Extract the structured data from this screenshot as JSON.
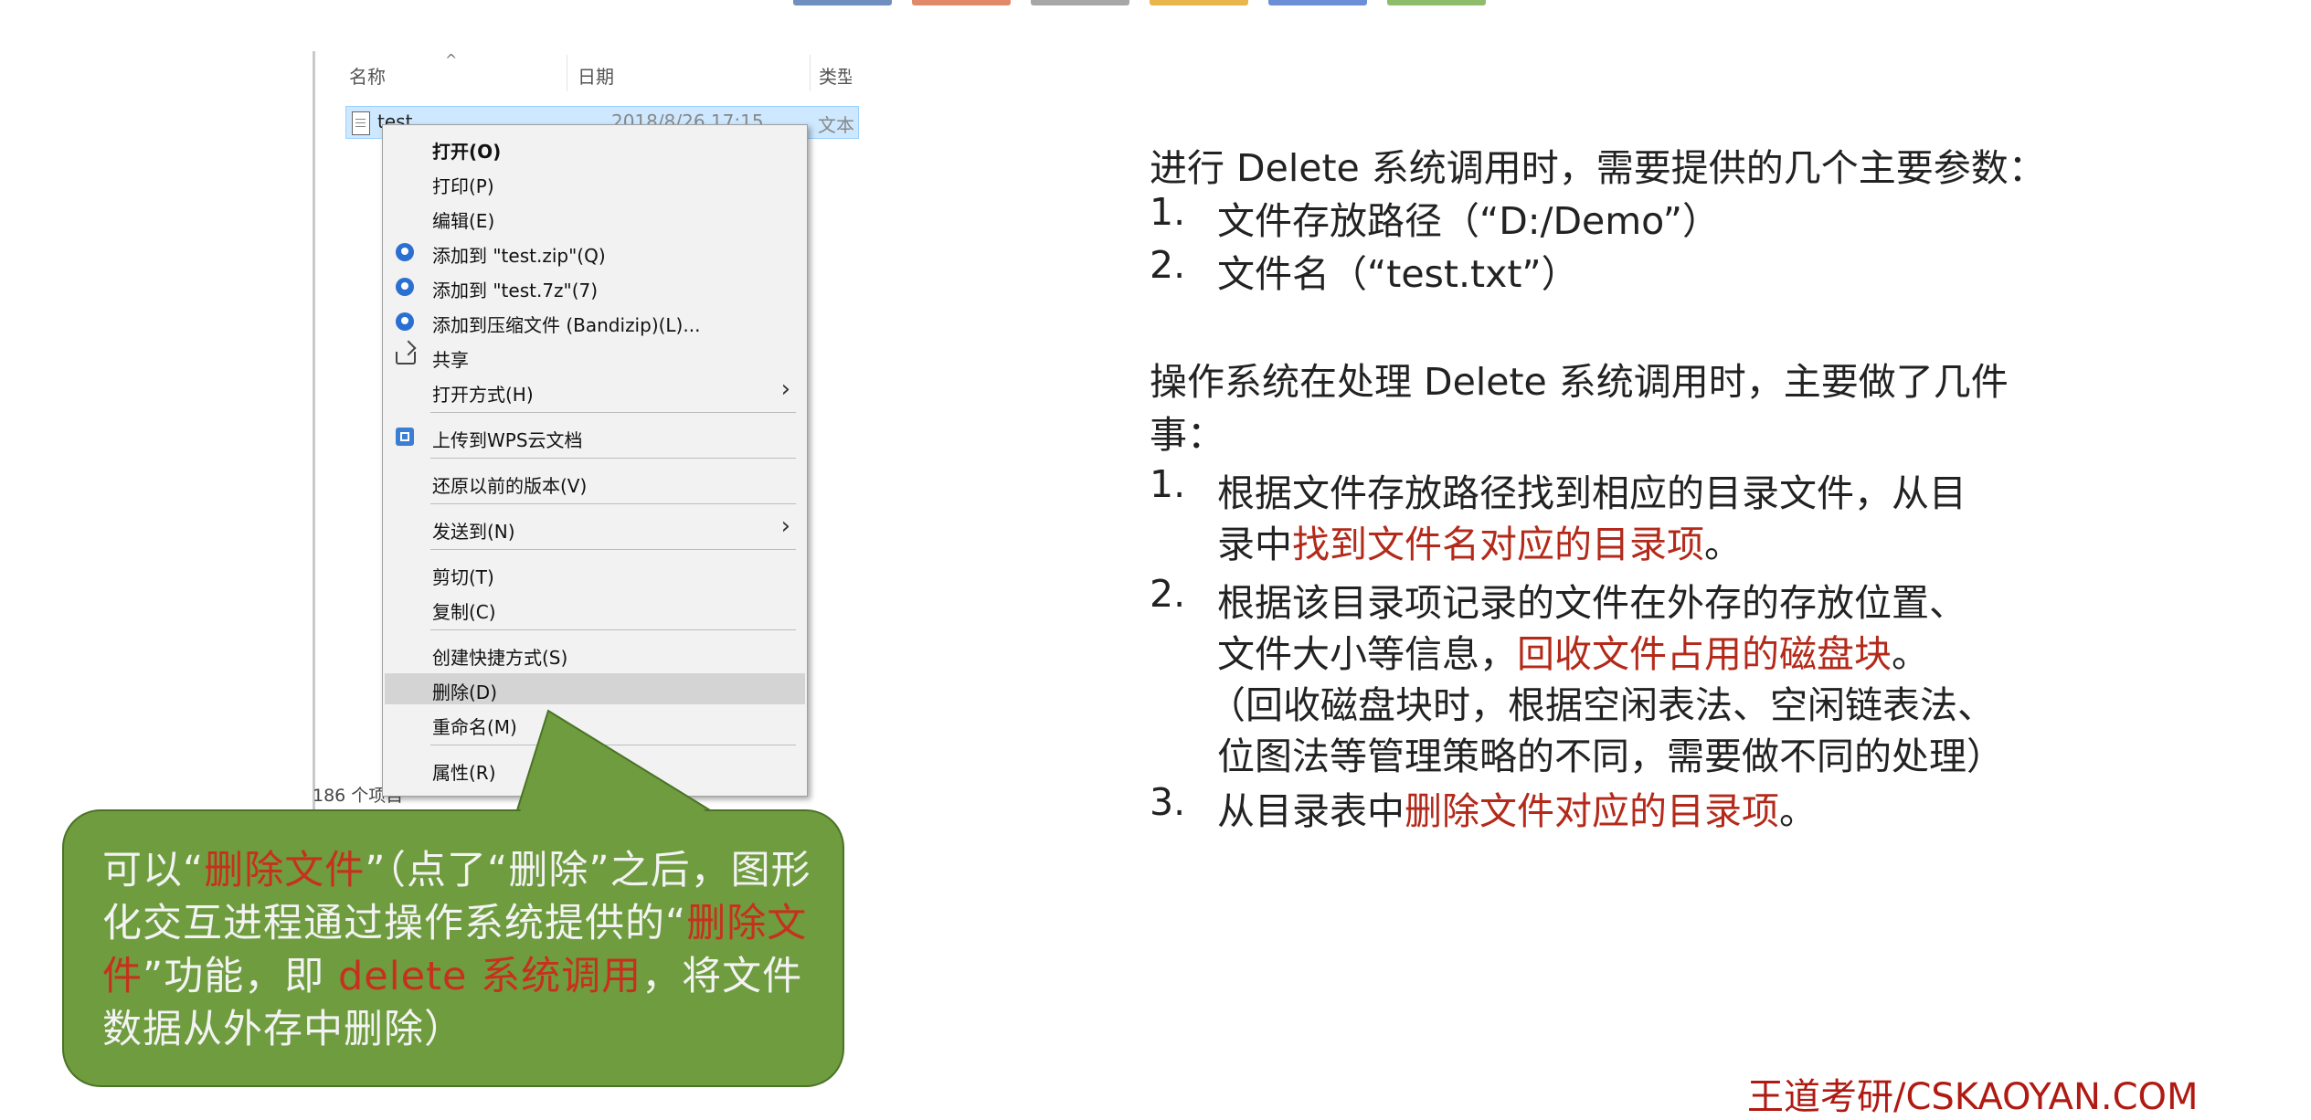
{
  "top_strip_colors": [
    "#6f8fbf",
    "#e08a6a",
    "#a7a7a7",
    "#e8b64a",
    "#6a8fd6",
    "#8dbd6a"
  ],
  "explorer": {
    "columns": {
      "name": "名称",
      "date": "日期",
      "type": "类型"
    },
    "sort_arrow": "^",
    "file": {
      "name": "test",
      "date": "2018/8/26 17:15",
      "type": "文本"
    },
    "status": "186 个项目"
  },
  "context_menu": {
    "items": {
      "open": "打开(O)",
      "print": "打印(P)",
      "edit": "编辑(E)",
      "add_zip": "添加到 \"test.zip\"(Q)",
      "add_7z": "添加到 \"test.7z\"(7)",
      "add_bandizip": "添加到压缩文件 (Bandizip)(L)...",
      "share": "共享",
      "open_with": "打开方式(H)",
      "upload_wps": "上传到WPS云文档",
      "restore": "还原以前的版本(V)",
      "send_to": "发送到(N)",
      "cut": "剪切(T)",
      "copy": "复制(C)",
      "create_shortcut": "创建快捷方式(S)",
      "delete": "删除(D)",
      "rename": "重命名(M)",
      "properties": "属性(R)"
    },
    "submenu_arrow": "›"
  },
  "callout": {
    "p1": "可以“",
    "p2": "删除文件",
    "p3": "”（点了“删除”之后，图形化交互进程通过操作系统提供的“",
    "p4": "删除文件",
    "p5": "”功能，即 ",
    "p6": "delete 系统调用",
    "p7": "，将文件数据从外存中删除）",
    "bg_color": "#6e9c3e",
    "highlight_color": "#c8301e"
  },
  "right": {
    "intro": "进行 Delete 系统调用时，需要提供的几个主要参数：",
    "params": [
      {
        "num": "1.",
        "text": "文件存放路径（“D:/Demo”）"
      },
      {
        "num": "2.",
        "text": "文件名（“test.txt”）"
      }
    ],
    "ops_line1": "操作系统在处理 Delete 系统调用时，主要做了几件",
    "ops_line2": "事：",
    "step1": {
      "num": "1.",
      "l1": "根据文件存放路径找到相应的目录文件，从目",
      "l2a": "录中",
      "l2b": "找到文件名对应的目录项",
      "l2c": "。"
    },
    "step2": {
      "num": "2.",
      "l1": "根据该目录项记录的文件在外存的存放位置、",
      "l2a": "文件大小等信息，",
      "l2b": "回收文件占用的磁盘块",
      "l2c": "。",
      "l3": "（回收磁盘块时，根据空闲表法、空闲链表法、",
      "l4": "位图法等管理策略的不同，需要做不同的处理）"
    },
    "step3": {
      "num": "3.",
      "a": "从目录表中",
      "b": "删除文件对应的目录项",
      "c": "。"
    },
    "highlight_color": "#b32a1a"
  },
  "watermark": "王道考研/CSKAOYAN.COM"
}
